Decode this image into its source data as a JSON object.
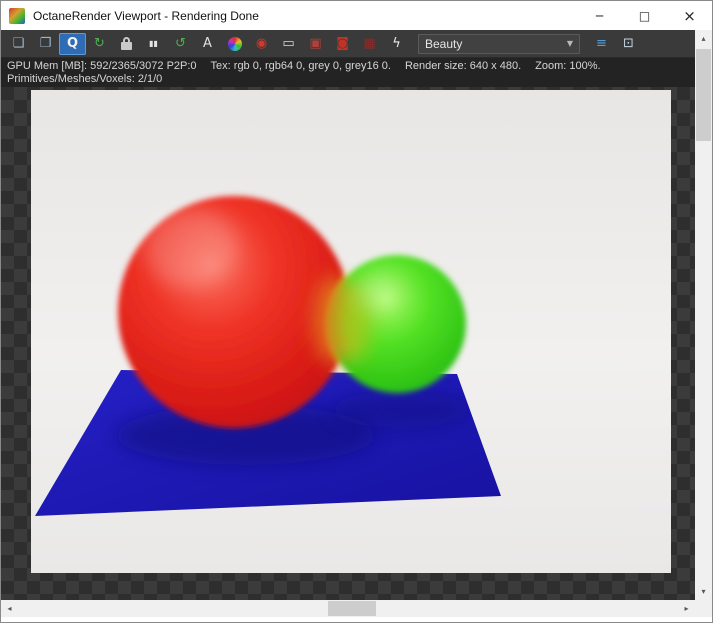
{
  "window": {
    "title": "OctaneRender Viewport - Rendering Done",
    "controls": {
      "minimize": "─",
      "maximize": "□",
      "close": "×"
    }
  },
  "colors": {
    "titlebar_bg": "#ffffff",
    "toolbar_bg": "#3a3a3a",
    "status_bg": "#232323",
    "active_tool": "#2e6db6",
    "checker_dark": "#2e2e2e",
    "checker_light": "#3b3b3b",
    "scrollbar_track": "#f0f0f0",
    "scrollbar_thumb": "#cdcdcd"
  },
  "toolbar": {
    "icons_left": [
      {
        "name": "save-image-icon",
        "glyph": "❏",
        "color": "#9fb6cd"
      },
      {
        "name": "copy-to-clipboard-icon",
        "glyph": "❐",
        "color": "#9fb6cd"
      },
      {
        "name": "focus-picker-icon",
        "glyph": "Q",
        "color": "#f2f2f2",
        "active": true
      },
      {
        "name": "refresh-render-icon",
        "glyph": "↻",
        "color": "#4ab34e"
      },
      {
        "name": "lock-resolution-icon",
        "type": "lock"
      },
      {
        "name": "pause-render-icon",
        "glyph": "▮▮",
        "color": "#e4e4e4",
        "size": 8
      },
      {
        "name": "restart-render-icon",
        "glyph": "↺",
        "color": "#4ab34e"
      },
      {
        "name": "text-overlay-icon",
        "glyph": "A",
        "color": "#e0e0e0"
      },
      {
        "name": "color-wheel-icon",
        "type": "wheel"
      },
      {
        "name": "render-priority-icon",
        "glyph": "◉",
        "color": "#cc3a30"
      },
      {
        "name": "monitor-icon",
        "glyph": "▭",
        "color": "#dcdcdc"
      },
      {
        "name": "camera-lock-icon",
        "glyph": "▣",
        "color": "#b24038"
      },
      {
        "name": "red-camera-icon",
        "glyph": "◙",
        "color": "#c03428"
      },
      {
        "name": "film-camera-icon",
        "glyph": "▦",
        "color": "#8c2a2a"
      },
      {
        "name": "gpu-boost-icon",
        "glyph": "ϟ",
        "color": "#ececec"
      }
    ],
    "render_mode": {
      "label": "Beauty",
      "arrow": "▼"
    },
    "icons_right": [
      {
        "name": "render-layers-icon",
        "glyph": "≡",
        "color": "#5b9bd5"
      },
      {
        "name": "expand-viewport-icon",
        "glyph": "⊡",
        "color": "#c7d5e3"
      }
    ]
  },
  "status": {
    "line1": [
      "GPU Mem [MB]: 592/2365/3072 P2P:0",
      "Tex: rgb 0, rgb64 0, grey 0, grey16 0.",
      "Render size: 640 x 480.",
      "Zoom: 100%."
    ],
    "line2": "Primitives/Meshes/Voxels: 2/1/0"
  },
  "viewport": {
    "render_size": "640 x 480",
    "zoom": "100%",
    "scene": {
      "description": "Red and green blended metaball spheres resting on a blue plane over a light gray background",
      "sphere_red": "#e02020",
      "sphere_green": "#38d818",
      "plane_blue": "#1d17b0",
      "background": "#efeeee"
    }
  },
  "scrollbars": {
    "up": "▴",
    "down": "▾",
    "left": "◂",
    "right": "▸"
  }
}
